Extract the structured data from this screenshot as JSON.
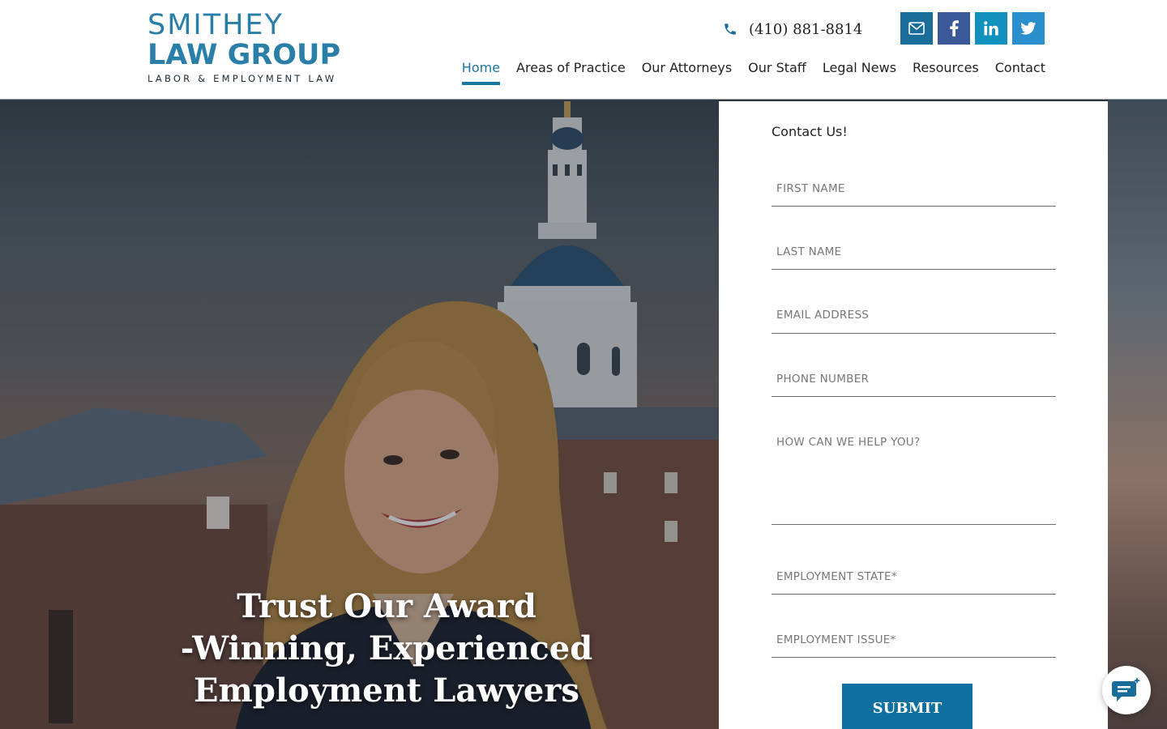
{
  "brand": {
    "line1": "SMITHEY",
    "line2": "LAW GROUP",
    "line3": "LABOR & EMPLOYMENT LAW",
    "color": "#2a7fa9"
  },
  "header": {
    "phone": "(410) 881-8814",
    "social": [
      {
        "icon": "envelope-icon",
        "color": "#1a6d98"
      },
      {
        "icon": "facebook-icon",
        "color": "#3b5998"
      },
      {
        "icon": "linkedin-icon",
        "color": "#1191bd"
      },
      {
        "icon": "twitter-icon",
        "color": "#2a8fcc"
      }
    ]
  },
  "nav": {
    "items": [
      "Home",
      "Areas of Practice",
      "Our Attorneys",
      "Our Staff",
      "Legal News",
      "Resources",
      "Contact"
    ],
    "active": "Home",
    "accent": "#1a77a0"
  },
  "hero": {
    "headline_lines": [
      "Trust Our Award",
      "-Winning, Experienced",
      "Employment Lawyers"
    ]
  },
  "form": {
    "title": "Contact Us!",
    "fields": {
      "first_name": "FIRST NAME",
      "last_name": "LAST NAME",
      "email": "EMAIL ADDRESS",
      "phone": "PHONE NUMBER",
      "message": "HOW CAN WE HELP YOU?",
      "state": "EMPLOYMENT STATE*",
      "issue": "EMPLOYMENT ISSUE*"
    },
    "submit_label": "SUBMIT",
    "submit_color": "#0e6fa0"
  }
}
